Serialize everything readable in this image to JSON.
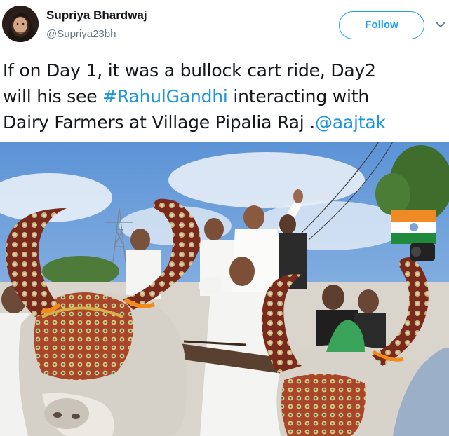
{
  "user": {
    "display_name": "Supriya Bhardwaj",
    "handle": "@Supriya23bh"
  },
  "follow_button": {
    "label": "Follow"
  },
  "tweet": {
    "line1": "If on Day 1, it was a bullock cart ride, Day2",
    "line2_before": "will his see ",
    "hashtag": "#RahulGandhi",
    "line2_after": " interacting with",
    "line3_before": "Dairy Farmers at Village Pipalia Raj .",
    "mention": "@aajtak"
  },
  "icons": {
    "avatar": "profile-photo",
    "more": "chevron-down-icon"
  },
  "colors": {
    "link": "#1b95e0",
    "follow_accent": "#1da1f2",
    "handle_gray": "#657786",
    "text": "#14171a"
  }
}
